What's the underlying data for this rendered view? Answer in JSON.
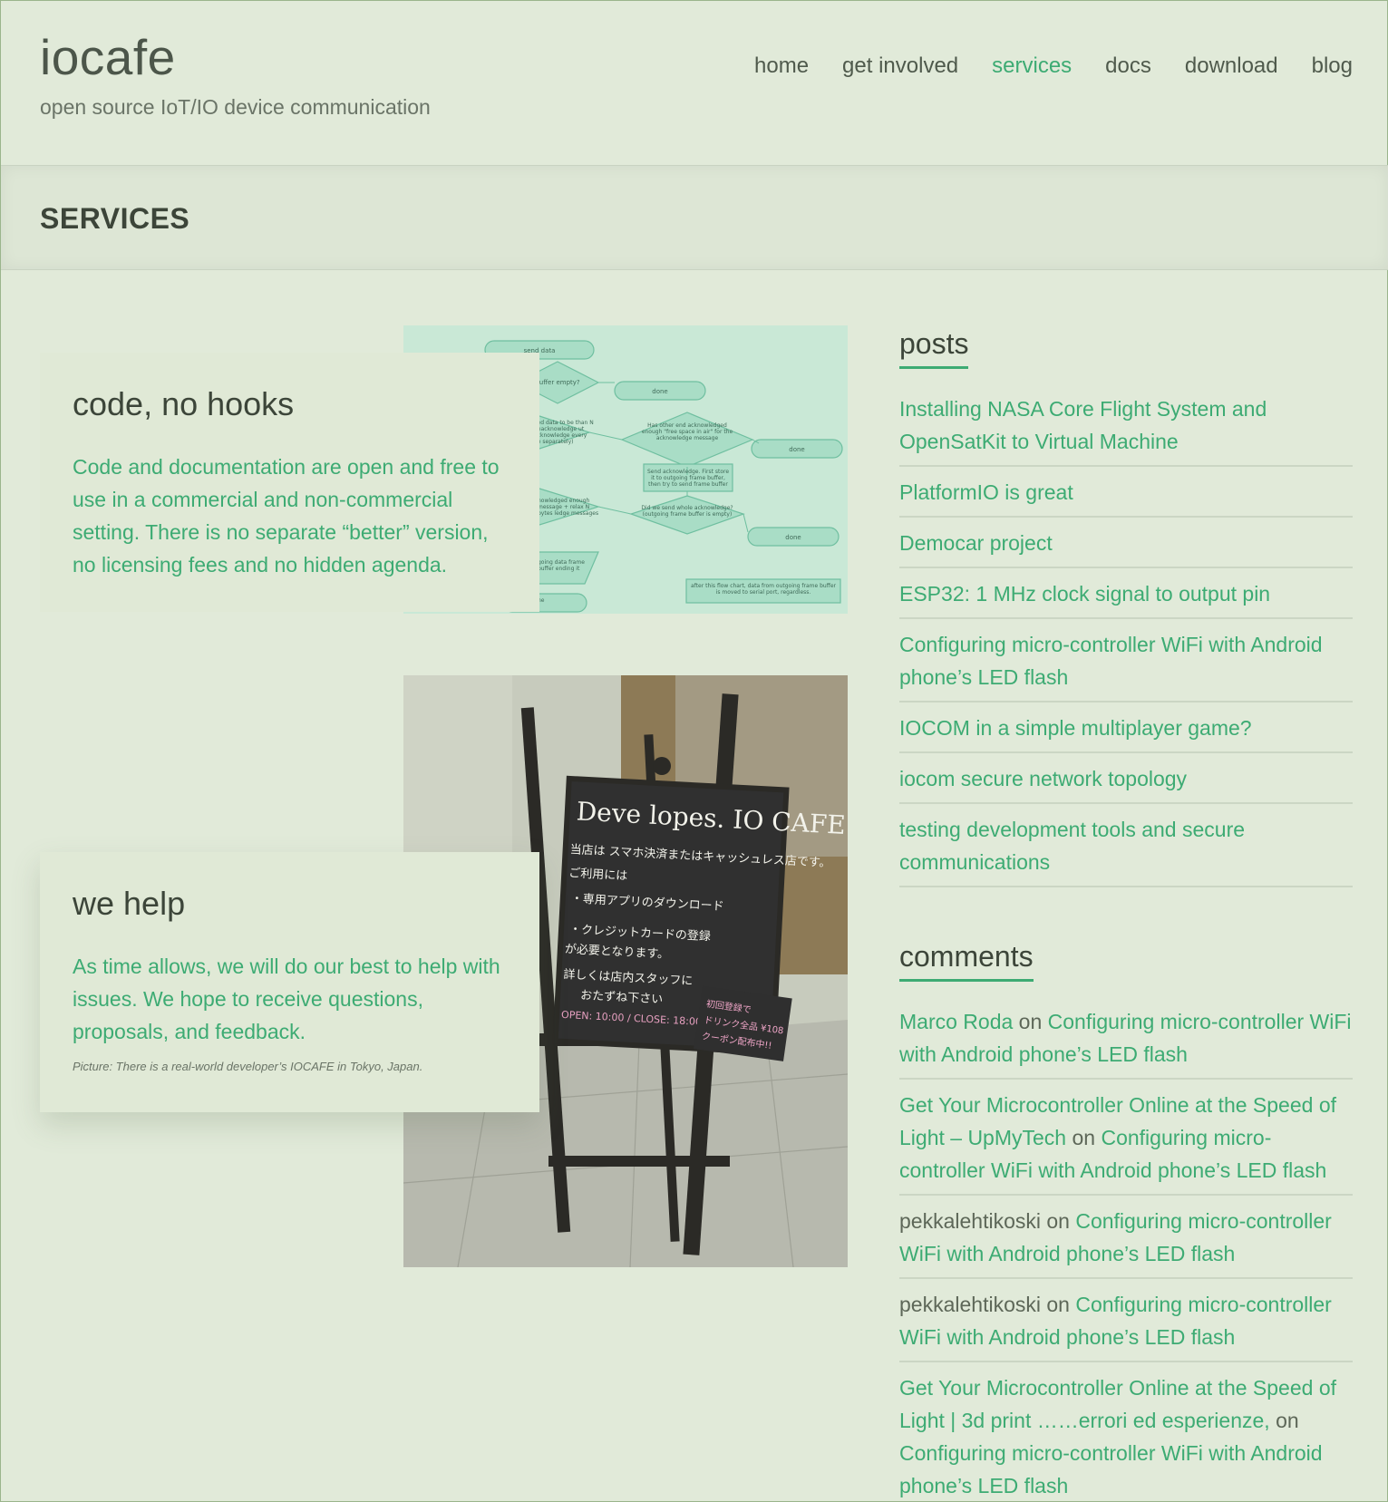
{
  "site": {
    "title": "iocafe",
    "description": "open source IoT/IO device communication"
  },
  "nav": {
    "items": [
      {
        "label": "home",
        "active": false
      },
      {
        "label": "get involved",
        "active": false
      },
      {
        "label": "services",
        "active": true
      },
      {
        "label": "docs",
        "active": false
      },
      {
        "label": "download",
        "active": false
      },
      {
        "label": "blog",
        "active": false
      }
    ]
  },
  "page": {
    "title": "SERVICES"
  },
  "features": [
    {
      "heading": "code, no hooks",
      "text": "Code and documentation are open and free to use in a commercial and non-commercial setting. There is no separate “better” version, no licensing fees and no hidden agenda.",
      "image": "flowchart-image"
    },
    {
      "heading": "we help",
      "text": "As time allows, we will do our best to help with issues. We hope to receive questions, proposals, and feedback.",
      "caption": "Picture: There is a real-world developer’s IOCAFE in Tokyo, Japan.",
      "image": "cafe-sign-photo"
    }
  ],
  "flowchart": {
    "nodes": [
      "send data",
      "done",
      "done",
      "done"
    ],
    "questions": [
      "buffer empty?",
      "Has other end acknowledged enough \"free space in air\" for the acknowledge message",
      "Did we send whole acknowledge? (outgoing frame buffer is empty)"
    ],
    "boxes": [
      "Send acknowledge. First store it to outgoing frame buffer, then try to send frame buffer",
      "after this flow chart, data from outgoing frame buffer is moved to serial port, regardless."
    ],
    "fragments": [
      "ved data to be than N unacknowledge ut acknowledge every ge separately)",
      "nowledged enough message + relax N bytes ledge messages",
      "going data frame buffer ending it",
      "ne"
    ]
  },
  "sign": {
    "title": "Deve lopes. IO CAFE",
    "line1": "当店は スマホ決済またはキャッシュレス店です。",
    "line2": "ご利用には",
    "line3": "・専用アプリのダウンロード",
    "line4": "・クレジットカードの登録",
    "line5": "が必要となります。",
    "line6": "詳しくは店内スタッフに",
    "line7": "おたずね下さい",
    "hours": "OPEN: 10:00 / CLOSE: 18:00",
    "card1": "初回登録で",
    "card2": "ドリンク全品 ¥108",
    "card3": "クーポン配布中!!"
  },
  "sidebar": {
    "posts_title": "posts",
    "posts": [
      "Installing NASA Core Flight System and OpenSatKit to Virtual Machine",
      "PlatformIO is great",
      "Democar project",
      "ESP32: 1 MHz clock signal to output pin",
      "Configuring micro-controller WiFi with Android phone’s LED flash",
      "IOCOM in a simple multiplayer game?",
      "iocom secure network topology",
      "testing development tools and secure communications"
    ],
    "comments_title": "comments",
    "comments": [
      {
        "author": "Marco Roda",
        "author_link": true,
        "on": "on",
        "post": "Configuring micro-controller WiFi with Android phone’s LED flash"
      },
      {
        "author": "Get Your Microcontroller Online at the Speed of Light – UpMyTech",
        "author_link": true,
        "on": "on",
        "post": "Configuring micro-controller WiFi with Android phone’s LED flash"
      },
      {
        "author": "pekkalehtikoski",
        "author_link": false,
        "on": "on",
        "post": "Configuring micro-controller WiFi with Android phone’s LED flash"
      },
      {
        "author": "pekkalehtikoski",
        "author_link": false,
        "on": "on",
        "post": "Configuring micro-controller WiFi with Android phone’s LED flash"
      },
      {
        "author": "Get Your Microcontroller Online at the Speed of Light | 3d print ……errori ed esperienze,",
        "author_link": true,
        "on": "on",
        "post": "Configuring micro-controller WiFi with Android phone’s LED flash"
      }
    ]
  },
  "colors": {
    "background": "#e1ead9",
    "accent": "#3dab73",
    "text": "#3c4539",
    "flowchart_bg": "#c9e8d6",
    "flowchart_shape": "#a7dcc5"
  }
}
